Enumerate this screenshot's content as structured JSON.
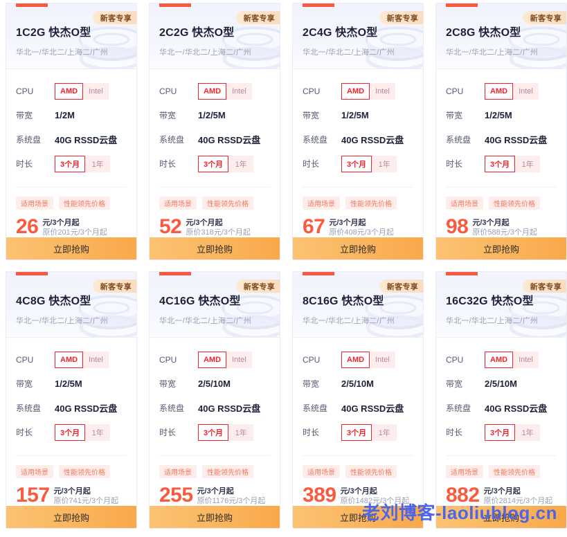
{
  "page": {
    "watermark": "老刘博客-laoliublog.cn",
    "accent_red": "#fb5741",
    "accent_orange": "#fbb65f",
    "badge_text_color": "#7d4a1e",
    "price_color": "#fa5a3d"
  },
  "labels": {
    "cpu": "CPU",
    "bandwidth": "带宽",
    "sysdisk": "系统盘",
    "duration": "时长",
    "badge": "新客专享",
    "tag_scene": "适用场景",
    "tag_price": "性能领先价格",
    "buy": "立即抢购",
    "cpu_amd": "AMD",
    "cpu_intel": "Intel",
    "dur_3m": "3个月",
    "dur_1y": "1年",
    "unit": "元/3个月起"
  },
  "cards": [
    {
      "title": "1C2G 快杰O型",
      "region": "华北一/华北二/上海二/广州",
      "cpu_selected": "AMD",
      "bandwidth": "1/2M",
      "sysdisk": "40G RSSD云盘",
      "duration_selected": "3个月",
      "price": "26",
      "orig": "原价201元/3个月起"
    },
    {
      "title": "2C2G 快杰O型",
      "region": "华北一/华北二/上海二/广州",
      "cpu_selected": "AMD",
      "bandwidth": "1/2/5M",
      "sysdisk": "40G RSSD云盘",
      "duration_selected": "3个月",
      "price": "52",
      "orig": "原价318元/3个月起"
    },
    {
      "title": "2C4G 快杰O型",
      "region": "华北一/华北二/上海二/广州",
      "cpu_selected": "AMD",
      "bandwidth": "1/2/5M",
      "sysdisk": "40G RSSD云盘",
      "duration_selected": "3个月",
      "price": "67",
      "orig": "原价408元/3个月起"
    },
    {
      "title": "2C8G 快杰O型",
      "region": "华北一/华北二/上海二/广州",
      "cpu_selected": "AMD",
      "bandwidth": "1/2/5M",
      "sysdisk": "40G RSSD云盘",
      "duration_selected": "3个月",
      "price": "98",
      "orig": "原价588元/3个月起"
    },
    {
      "title": "4C8G 快杰O型",
      "region": "华北一/华北二/上海二/广州",
      "cpu_selected": "AMD",
      "bandwidth": "1/2/5M",
      "sysdisk": "40G RSSD云盘",
      "duration_selected": "3个月",
      "price": "157",
      "orig": "原价741元/3个月起"
    },
    {
      "title": "4C16G 快杰O型",
      "region": "华北一/华北二/上海二/广州",
      "cpu_selected": "AMD",
      "bandwidth": "2/5/10M",
      "sysdisk": "40G RSSD云盘",
      "duration_selected": "3个月",
      "price": "255",
      "orig": "原价1176元/3个月起"
    },
    {
      "title": "8C16G 快杰O型",
      "region": "华北一/华北二/上海二/广州",
      "cpu_selected": "AMD",
      "bandwidth": "2/5/10M",
      "sysdisk": "40G RSSD云盘",
      "duration_selected": "3个月",
      "price": "389",
      "orig": "原价1482元/3个月起"
    },
    {
      "title": "16C32G 快杰O型",
      "region": "华北一/华北二/上海二/广州",
      "cpu_selected": "AMD",
      "bandwidth": "2/5/10M",
      "sysdisk": "40G RSSD云盘",
      "duration_selected": "3个月",
      "price": "882",
      "orig": "原价2814元/3个月起"
    }
  ]
}
